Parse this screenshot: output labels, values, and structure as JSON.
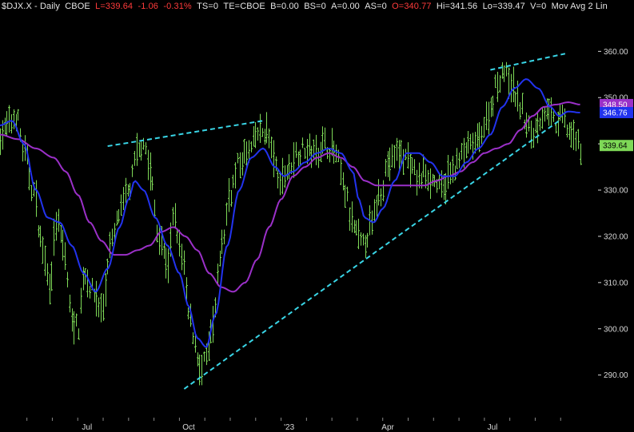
{
  "header": {
    "symbol": "$DJX.X",
    "sep1": " - ",
    "interval": "Daily",
    "exchange": "CBOE",
    "last": "L=339.64",
    "change": "-1.06",
    "change_pct": "-0.31%",
    "ts": "TS=0",
    "te": "TE=CBOE",
    "b": "B=0.00",
    "bs": "BS=0",
    "a": "A=0.00",
    "as": "AS=0",
    "open": "O=340.77",
    "hi": "Hi=341.56",
    "lo": "Lo=339.47",
    "vol": "V=0",
    "study": "Mov Avg 2 Lin"
  },
  "colors": {
    "background": "#000000",
    "bars": "#7ed957",
    "fast_ma": "#2233ee",
    "slow_ma": "#9b30c8",
    "trendline": "#39d5e6",
    "axis_text": "#d8d8d8",
    "price_badge": "#7ed957",
    "slow_badge": "#9b30c8",
    "fast_badge": "#2233ee"
  },
  "chart_data": {
    "type": "ohlc",
    "y_ticks": [
      290,
      300,
      310,
      320,
      330,
      340,
      350,
      360
    ],
    "y_tick_labels": [
      "290.00",
      "300.00",
      "310.00",
      "320.00",
      "330.00",
      "340.00",
      "350.00",
      "360.00"
    ],
    "ylim": [
      282,
      368
    ],
    "x_labels": [
      {
        "label": "Jul",
        "t": 0.1455
      },
      {
        "label": "Oct",
        "t": 0.3155
      },
      {
        "label": "'23",
        "t": 0.4835
      },
      {
        "label": "Apr",
        "t": 0.6485
      },
      {
        "label": "Jul",
        "t": 0.8235
      }
    ],
    "last_price": {
      "value": 339.64,
      "label": "339.64"
    },
    "ma_slow_last": {
      "value": 348.5,
      "label": "348.50"
    },
    "ma_fast_last": {
      "value": 346.76,
      "label": "346.76"
    },
    "price_anchors": [
      [
        0.0,
        342
      ],
      [
        0.015,
        344
      ],
      [
        0.027,
        346
      ],
      [
        0.04,
        338
      ],
      [
        0.055,
        330
      ],
      [
        0.07,
        318
      ],
      [
        0.082,
        310
      ],
      [
        0.095,
        323
      ],
      [
        0.108,
        316
      ],
      [
        0.118,
        303
      ],
      [
        0.13,
        300
      ],
      [
        0.14,
        312
      ],
      [
        0.155,
        308
      ],
      [
        0.17,
        304
      ],
      [
        0.185,
        318
      ],
      [
        0.2,
        325
      ],
      [
        0.215,
        330
      ],
      [
        0.23,
        338
      ],
      [
        0.24,
        341
      ],
      [
        0.25,
        334
      ],
      [
        0.265,
        320
      ],
      [
        0.28,
        314
      ],
      [
        0.29,
        324
      ],
      [
        0.305,
        315
      ],
      [
        0.315,
        303
      ],
      [
        0.325,
        298
      ],
      [
        0.335,
        290
      ],
      [
        0.345,
        294
      ],
      [
        0.355,
        300
      ],
      [
        0.37,
        318
      ],
      [
        0.385,
        330
      ],
      [
        0.4,
        336
      ],
      [
        0.415,
        338
      ],
      [
        0.43,
        342
      ],
      [
        0.445,
        343
      ],
      [
        0.455,
        338
      ],
      [
        0.465,
        332
      ],
      [
        0.48,
        334
      ],
      [
        0.495,
        338
      ],
      [
        0.51,
        339
      ],
      [
        0.525,
        338
      ],
      [
        0.54,
        340
      ],
      [
        0.555,
        339
      ],
      [
        0.565,
        336
      ],
      [
        0.575,
        330
      ],
      [
        0.59,
        322
      ],
      [
        0.605,
        318
      ],
      [
        0.62,
        322
      ],
      [
        0.635,
        330
      ],
      [
        0.65,
        336
      ],
      [
        0.665,
        338
      ],
      [
        0.68,
        337
      ],
      [
        0.69,
        334
      ],
      [
        0.7,
        332
      ],
      [
        0.71,
        334
      ],
      [
        0.725,
        332
      ],
      [
        0.74,
        330
      ],
      [
        0.75,
        333
      ],
      [
        0.765,
        336
      ],
      [
        0.78,
        339
      ],
      [
        0.795,
        340
      ],
      [
        0.81,
        344
      ],
      [
        0.82,
        348
      ],
      [
        0.83,
        353
      ],
      [
        0.84,
        356
      ],
      [
        0.85,
        354
      ],
      [
        0.86,
        351
      ],
      [
        0.87,
        348
      ],
      [
        0.88,
        344
      ],
      [
        0.89,
        342
      ],
      [
        0.9,
        345
      ],
      [
        0.91,
        347
      ],
      [
        0.92,
        346
      ],
      [
        0.93,
        344
      ],
      [
        0.94,
        346
      ],
      [
        0.95,
        343
      ],
      [
        0.96,
        341
      ],
      [
        0.97,
        339.64
      ]
    ],
    "ma_fast_anchors": [
      [
        0.0,
        344
      ],
      [
        0.02,
        345
      ],
      [
        0.04,
        340
      ],
      [
        0.06,
        330
      ],
      [
        0.08,
        324
      ],
      [
        0.1,
        323
      ],
      [
        0.12,
        318
      ],
      [
        0.14,
        312
      ],
      [
        0.16,
        308
      ],
      [
        0.18,
        313
      ],
      [
        0.2,
        322
      ],
      [
        0.215,
        328
      ],
      [
        0.225,
        332
      ],
      [
        0.24,
        330
      ],
      [
        0.26,
        324
      ],
      [
        0.28,
        318
      ],
      [
        0.3,
        312
      ],
      [
        0.315,
        305
      ],
      [
        0.33,
        298
      ],
      [
        0.345,
        296
      ],
      [
        0.36,
        303
      ],
      [
        0.38,
        318
      ],
      [
        0.4,
        330
      ],
      [
        0.42,
        337
      ],
      [
        0.44,
        339
      ],
      [
        0.46,
        335
      ],
      [
        0.475,
        333
      ],
      [
        0.49,
        334
      ],
      [
        0.51,
        336
      ],
      [
        0.53,
        338
      ],
      [
        0.55,
        339
      ],
      [
        0.57,
        338
      ],
      [
        0.59,
        334
      ],
      [
        0.6,
        328
      ],
      [
        0.61,
        324
      ],
      [
        0.625,
        323
      ],
      [
        0.64,
        326
      ],
      [
        0.66,
        332
      ],
      [
        0.68,
        338
      ],
      [
        0.7,
        338
      ],
      [
        0.72,
        336
      ],
      [
        0.74,
        333
      ],
      [
        0.76,
        333
      ],
      [
        0.78,
        336
      ],
      [
        0.8,
        339
      ],
      [
        0.82,
        342
      ],
      [
        0.84,
        348
      ],
      [
        0.86,
        352
      ],
      [
        0.88,
        354
      ],
      [
        0.9,
        352
      ],
      [
        0.92,
        348
      ],
      [
        0.935,
        346
      ],
      [
        0.95,
        347
      ],
      [
        0.97,
        346.76
      ]
    ],
    "ma_slow_anchors": [
      [
        0.0,
        342
      ],
      [
        0.03,
        341
      ],
      [
        0.06,
        339
      ],
      [
        0.09,
        337
      ],
      [
        0.11,
        334
      ],
      [
        0.13,
        329
      ],
      [
        0.15,
        323
      ],
      [
        0.17,
        319
      ],
      [
        0.19,
        316
      ],
      [
        0.21,
        316
      ],
      [
        0.23,
        317
      ],
      [
        0.25,
        318
      ],
      [
        0.27,
        321
      ],
      [
        0.29,
        322
      ],
      [
        0.31,
        320
      ],
      [
        0.33,
        317
      ],
      [
        0.35,
        312
      ],
      [
        0.37,
        309
      ],
      [
        0.39,
        308
      ],
      [
        0.41,
        310
      ],
      [
        0.43,
        315
      ],
      [
        0.45,
        322
      ],
      [
        0.47,
        328
      ],
      [
        0.49,
        333
      ],
      [
        0.51,
        335
      ],
      [
        0.53,
        337
      ],
      [
        0.55,
        338
      ],
      [
        0.57,
        337
      ],
      [
        0.59,
        335
      ],
      [
        0.61,
        332
      ],
      [
        0.63,
        331
      ],
      [
        0.65,
        331
      ],
      [
        0.67,
        331
      ],
      [
        0.69,
        331
      ],
      [
        0.71,
        331
      ],
      [
        0.73,
        332
      ],
      [
        0.75,
        333
      ],
      [
        0.77,
        334
      ],
      [
        0.79,
        336
      ],
      [
        0.81,
        338
      ],
      [
        0.83,
        339
      ],
      [
        0.85,
        340
      ],
      [
        0.87,
        343
      ],
      [
        0.89,
        346
      ],
      [
        0.91,
        348
      ],
      [
        0.93,
        348.5
      ],
      [
        0.95,
        349
      ],
      [
        0.97,
        348.5
      ]
    ],
    "trendlines": [
      {
        "name": "upper-left",
        "t1": 0.18,
        "v1": 339.5,
        "t2": 0.44,
        "v2": 345
      },
      {
        "name": "upper-right",
        "t1": 0.82,
        "v1": 356,
        "t2": 0.945,
        "v2": 359.5
      },
      {
        "name": "lower",
        "t1": 0.308,
        "v1": 287,
        "t2": 0.935,
        "v2": 345
      }
    ]
  }
}
